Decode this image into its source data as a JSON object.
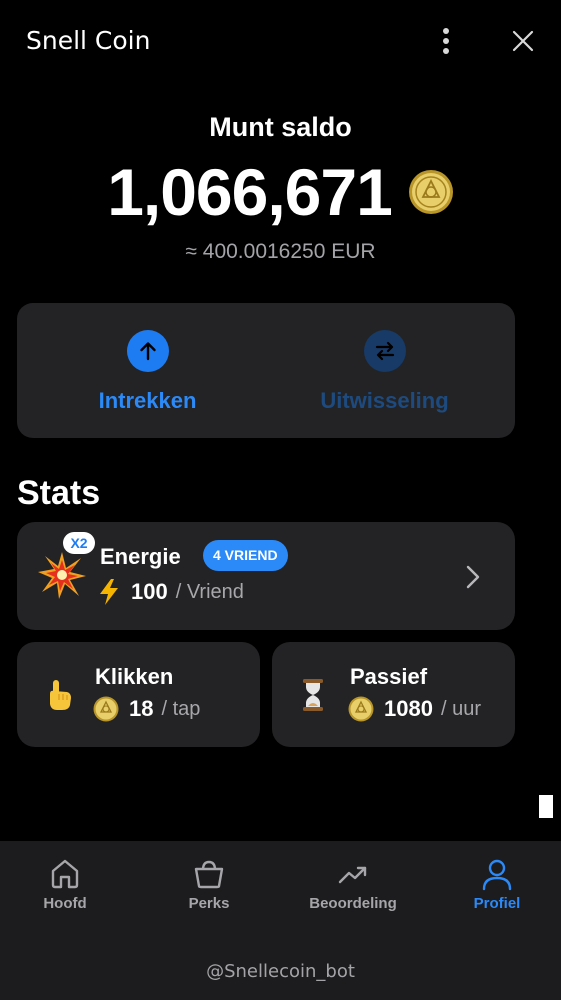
{
  "header": {
    "title": "Snell Coin",
    "menu_icon": "more-vertical-icon",
    "close_icon": "close-icon"
  },
  "balance": {
    "label": "Munt saldo",
    "value": "1,066,671",
    "eur": "≈ 400.0016250 EUR",
    "coin_icon": "coin-icon"
  },
  "actions": {
    "withdraw_label": "Intrekken",
    "withdraw_icon": "arrow-up-icon",
    "exchange_label": "Uitwisseling",
    "exchange_icon": "swap-arrows-icon"
  },
  "stats": {
    "title": "Stats",
    "energy": {
      "multiplier_badge": "X2",
      "title": "Energie",
      "friend_badge": "4 VRIEND",
      "value": "100",
      "unit": "/ Vriend",
      "icon": "burst-icon"
    },
    "clicks": {
      "title": "Klikken",
      "value": "18",
      "unit": "/ tap",
      "icon": "pointing-hand-icon"
    },
    "passive": {
      "title": "Passief",
      "value": "1080",
      "unit": "/ uur",
      "icon": "hourglass-icon"
    }
  },
  "nav": {
    "items": [
      {
        "label": "Hoofd",
        "icon": "home-icon",
        "active": false
      },
      {
        "label": "Perks",
        "icon": "shopping-bag-icon",
        "active": false
      },
      {
        "label": "Beoordeling",
        "icon": "trending-up-icon",
        "active": false
      },
      {
        "label": "Profiel",
        "icon": "user-icon",
        "active": true
      }
    ],
    "bot_handle": "@Snellecoin_bot"
  },
  "colors": {
    "background": "#000000",
    "card": "#232325",
    "accent": "#2b8af7",
    "muted_text": "#a4a4a8",
    "nav_bar": "#1c1c1e"
  }
}
